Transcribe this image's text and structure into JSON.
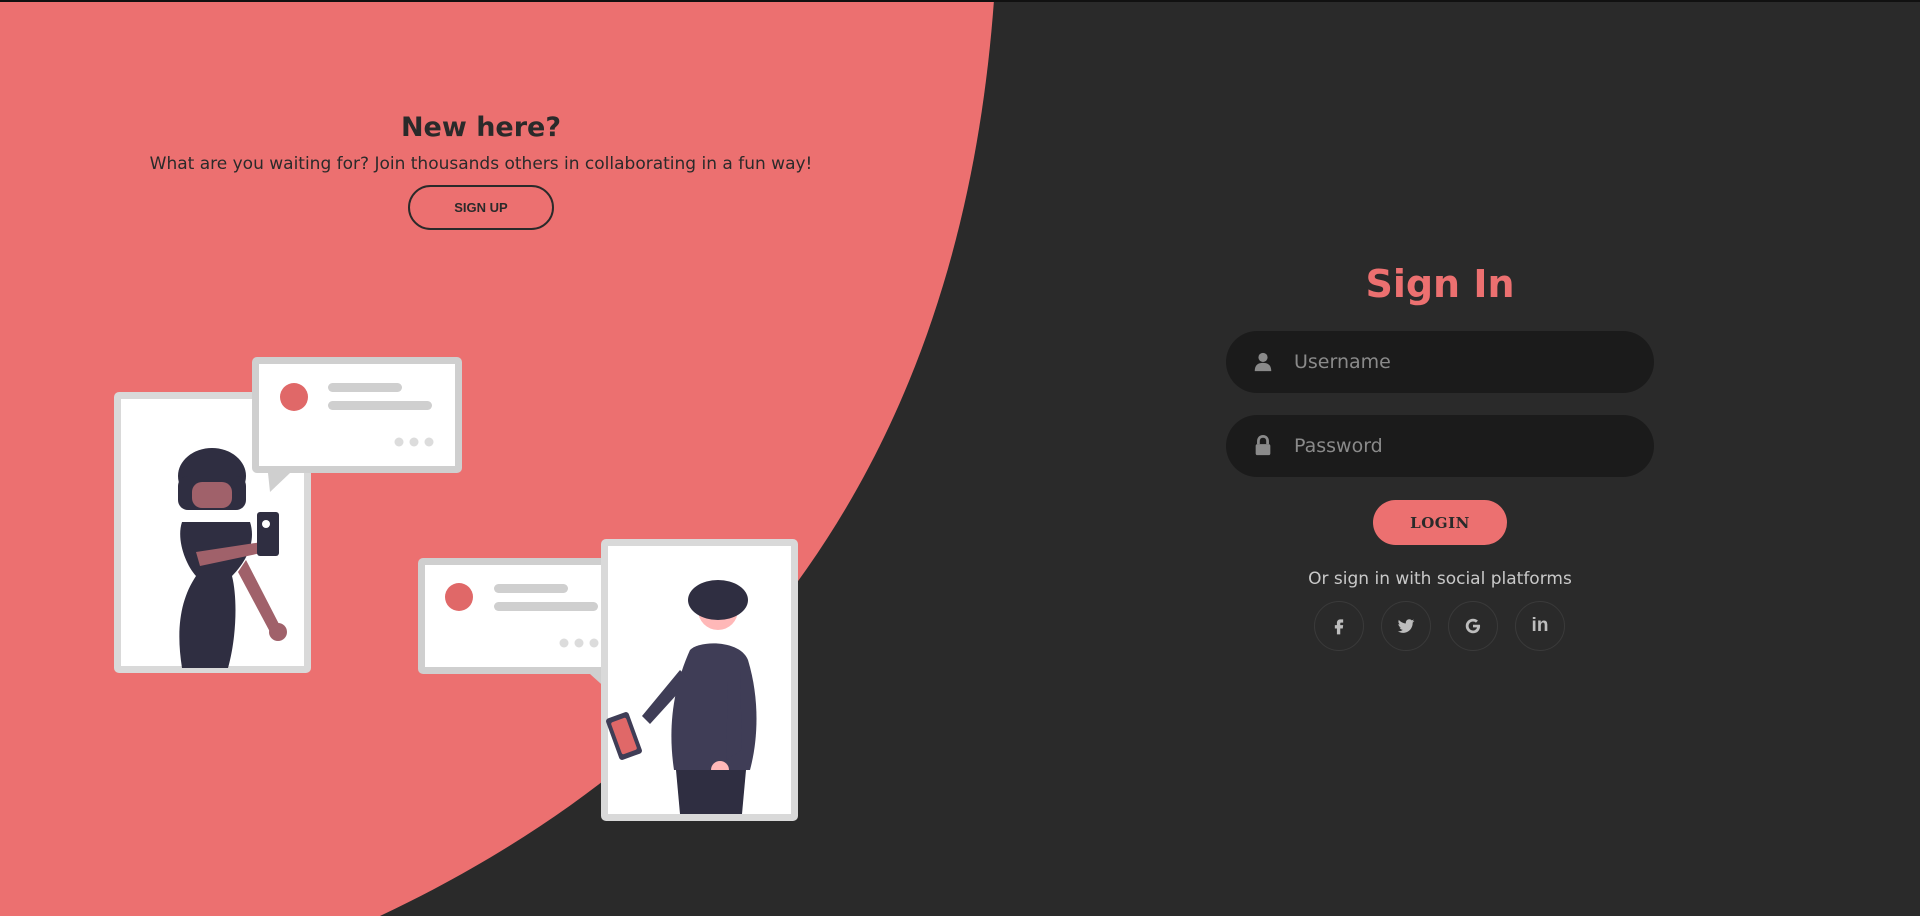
{
  "colors": {
    "accent": "#ec7070",
    "background": "#2a2a2a",
    "input_bg": "#1b1b1b"
  },
  "left_panel": {
    "title": "New here?",
    "text": "What are you waiting for? Join thousands others in collaborating in a fun way!",
    "signup_label": "SIGN UP"
  },
  "signin": {
    "title": "Sign In",
    "username": {
      "placeholder": "Username",
      "value": "",
      "icon": "user-icon"
    },
    "password": {
      "placeholder": "Password",
      "value": "",
      "icon": "lock-icon"
    },
    "login_label": "LOGIN",
    "social_text": "Or sign in with social platforms",
    "social": [
      {
        "name": "facebook",
        "icon": "facebook-icon"
      },
      {
        "name": "twitter",
        "icon": "twitter-icon"
      },
      {
        "name": "google",
        "icon": "google-icon"
      },
      {
        "name": "linkedin",
        "icon": "linkedin-icon",
        "label": "in"
      }
    ]
  }
}
